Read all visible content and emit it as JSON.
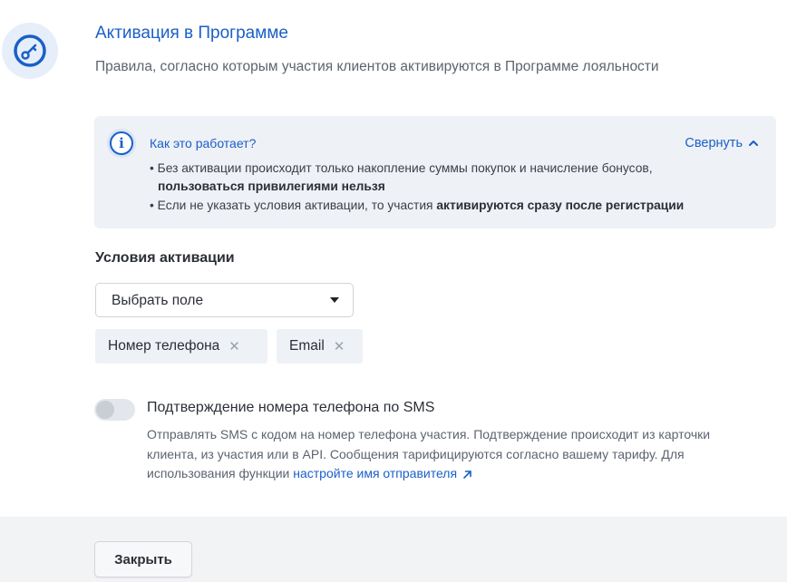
{
  "header": {
    "icon": "key-icon",
    "title": "Активация в Программе",
    "subtitle": "Правила, согласно которым участия клиентов активируются в Программе лояльности"
  },
  "info": {
    "icon": "info-icon",
    "title": "Как это работает?",
    "collapse_label": "Свернуть",
    "bullet1_text": "• Без активации происходит только накопление суммы покупок и начисление бонусов,",
    "bullet1_bold": "пользоваться привилегиями нельзя",
    "bullet2_text": "• Если не указать условия активации, то участия ",
    "bullet2_bold": "активируются сразу после регистрации"
  },
  "conditions": {
    "title": "Условия активации",
    "select_value": "Выбрать поле",
    "tags": [
      "Номер телефона",
      "Email"
    ],
    "remove_glyph": "✕"
  },
  "sms": {
    "enabled": false,
    "title": "Подтверждение номера телефона по SMS",
    "description": "Отправлять SMS с кодом на номер телефона участия. Подтверждение происходит из карточки клиента, из участия или в API. Сообщения тарифицируются согласно вашему тарифу. Для использования функции ",
    "link_label": "настройте имя отправителя"
  },
  "footer": {
    "close_label": "Закрыть"
  },
  "colors": {
    "accent": "#1a5fc9",
    "panel": "#eef1f5"
  }
}
